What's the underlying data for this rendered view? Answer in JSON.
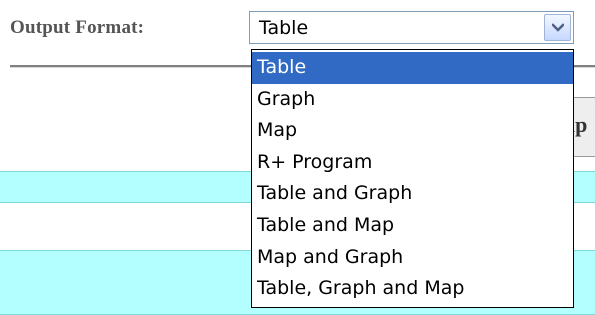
{
  "form": {
    "label": "Output Format:",
    "selected_value": "Table",
    "options": [
      "Table",
      "Graph",
      "Map",
      "R+ Program",
      "Table and Graph",
      "Table and Map",
      "Map and Graph",
      "Table, Graph and Map"
    ],
    "highlighted_option_index": 0,
    "partial_button_text": "lp"
  },
  "icons": {
    "dropdown_arrow": "chevron-down-icon"
  },
  "colors": {
    "label_text": "#555555",
    "cyan_band": "#b3ffff",
    "highlight": "#316ac5",
    "select_border": "#7f9db9"
  }
}
